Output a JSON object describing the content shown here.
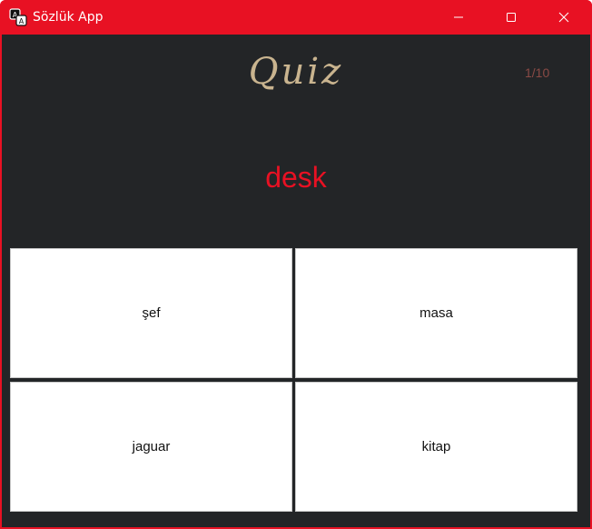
{
  "window": {
    "title": "Sözlük App",
    "app_icon": "dictionary-icon",
    "accent_color": "#e81123",
    "controls": {
      "minimize_icon": "minimize-icon",
      "maximize_icon": "maximize-icon",
      "close_icon": "close-icon"
    }
  },
  "quiz": {
    "heading": "Quiz",
    "progress": "1/10",
    "question_word": "desk",
    "answers": [
      {
        "label": "şef"
      },
      {
        "label": "masa"
      },
      {
        "label": "jaguar"
      },
      {
        "label": "kitap"
      }
    ],
    "colors": {
      "background": "#232527",
      "heading": "#c9b48f",
      "progress": "#8a4a45",
      "question": "#e81123"
    }
  }
}
